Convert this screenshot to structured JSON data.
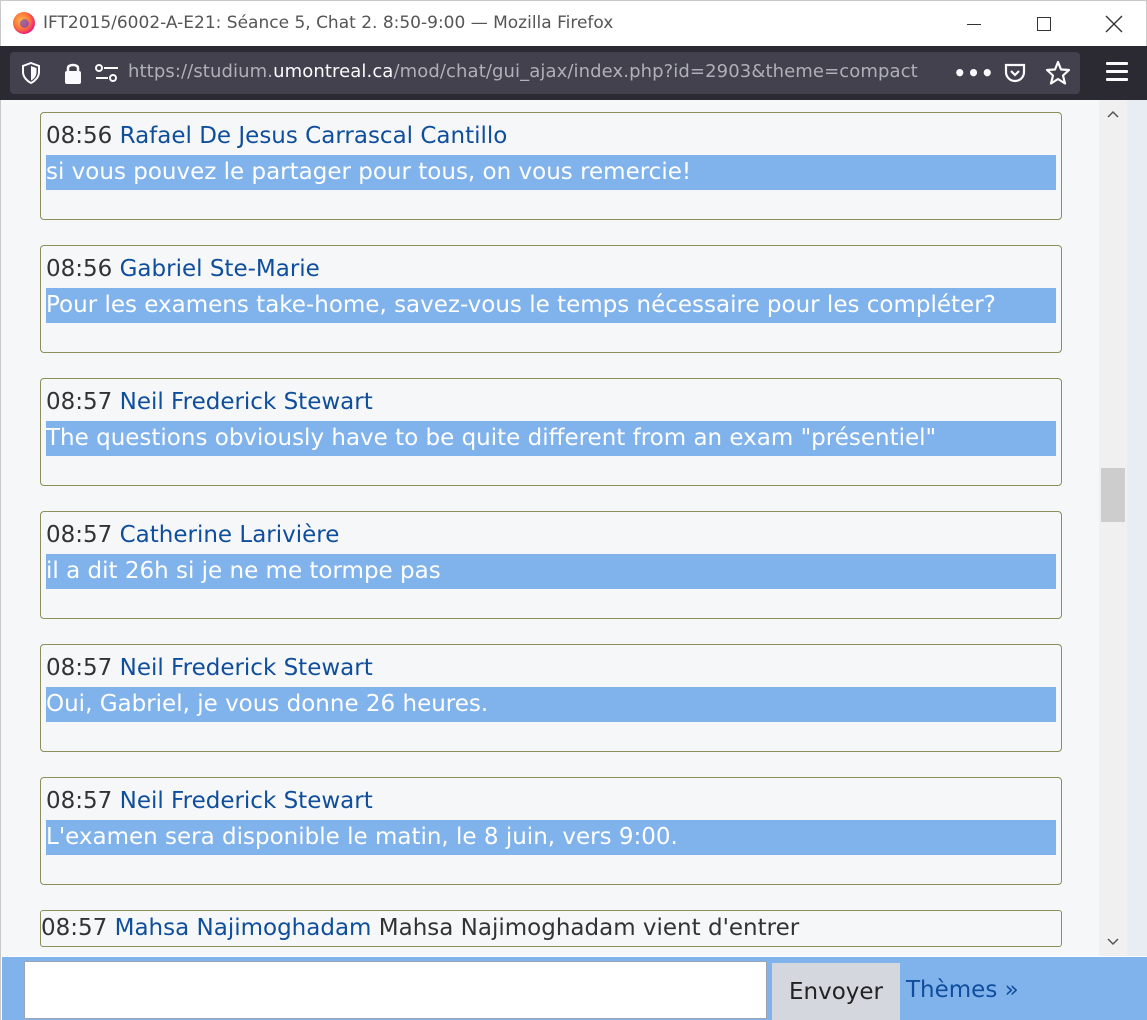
{
  "window": {
    "title": "IFT2015/6002-A-E21: Séance 5, Chat 2. 8:50-9:00 — Mozilla Firefox",
    "minimize_icon": "minimize-icon",
    "maximize_icon": "maximize-icon",
    "close_icon": "close-icon"
  },
  "navbar": {
    "url_prefix": "https://studium.",
    "url_domain": "umontreal.ca",
    "url_suffix": "/mod/chat/gui_ajax/index.php?id=2903&theme=compact",
    "icons": [
      "tracking-shield-icon",
      "lock-icon",
      "permissions-icon",
      "page-actions-icon",
      "pocket-icon",
      "bookmark-star-icon",
      "hamburger-menu-icon"
    ]
  },
  "messages": [
    {
      "time": "08:56",
      "user": "Rafael De Jesus Carrascal Cantillo",
      "text": "si vous pouvez le partager pour tous, on vous remercie!"
    },
    {
      "time": "08:56",
      "user": "Gabriel Ste-Marie",
      "text": "Pour les examens take-home, savez-vous le temps nécessaire pour les compléter?"
    },
    {
      "time": "08:57",
      "user": "Neil Frederick Stewart",
      "text": "The questions obviously have to be quite different from an exam \"présentiel\""
    },
    {
      "time": "08:57",
      "user": "Catherine Larivière",
      "text": "il a dit 26h si je ne me tormpe pas"
    },
    {
      "time": "08:57",
      "user": "Neil Frederick Stewart",
      "text": "Oui, Gabriel, je vous donne 26 heures."
    },
    {
      "time": "08:57",
      "user": "Neil Frederick Stewart",
      "text": "L'examen sera disponible le matin, le 8 juin, vers 9:00."
    }
  ],
  "join_event": {
    "time": "08:57",
    "user": "Mahsa Najimoghadam",
    "text": "Mahsa Najimoghadam vient d'entrer"
  },
  "input_bar": {
    "message_value": "",
    "send_label": "Envoyer",
    "themes_label": "Thèmes »"
  },
  "colors": {
    "message_highlight": "#80b2ec",
    "username": "#0f4e9c",
    "navbar_bg": "#2b2a33",
    "input_bar_bg": "#80b2ec"
  }
}
